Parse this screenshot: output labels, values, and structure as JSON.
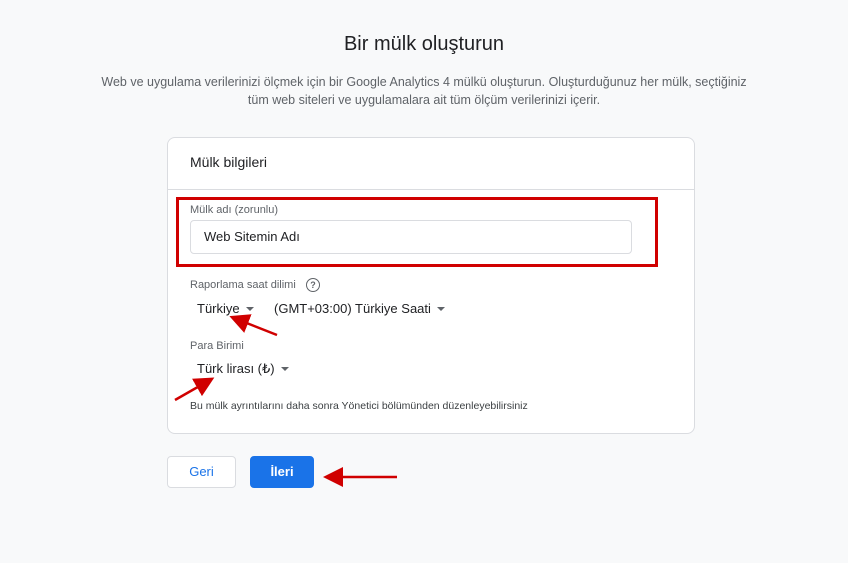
{
  "page": {
    "title": "Bir mülk oluşturun",
    "subtitle_line1": "Web ve uygulama verilerinizi ölçmek için bir Google Analytics 4 mülkü oluşturun. Oluşturduğunuz her mülk, seçtiğiniz",
    "subtitle_line2": "tüm web siteleri ve uygulamalara ait tüm ölçüm verilerinizi içerir."
  },
  "card": {
    "title": "Mülk bilgileri",
    "property_name_label": "Mülk adı (zorunlu)",
    "property_name_value": "Web Sitemin Adı",
    "timezone_label": "Raporlama saat dilimi",
    "help_icon_glyph": "?",
    "country_value": "Türkiye",
    "timezone_value": "(GMT+03:00) Türkiye Saati",
    "currency_label": "Para Birimi",
    "currency_value": "Türk lirası (₺)",
    "note": "Bu mülk ayrıntılarını daha sonra Yönetici bölümünden düzenleyebilirsiniz"
  },
  "buttons": {
    "back_label": "Geri",
    "next_label": "İleri"
  },
  "colors": {
    "accent": "#1a73e8",
    "annotation": "#d00000"
  }
}
